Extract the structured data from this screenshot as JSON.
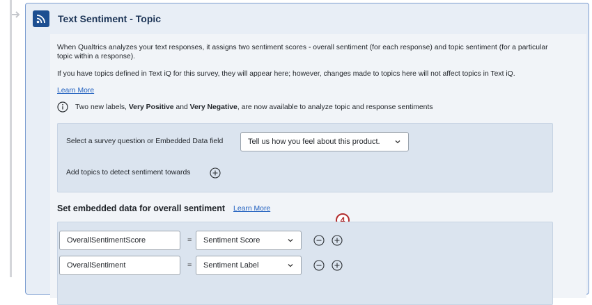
{
  "card": {
    "title": "Text Sentiment - Topic",
    "para1": "When Qualtrics analyzes your text responses, it assigns two sentiment scores - overall sentiment (for each response) and topic sentiment (for a particular topic within a response).",
    "para2": "If you have topics defined in Text iQ for this survey, they will appear here; however, changes made to topics here will not affect topics in Text iQ.",
    "learn_more": "Learn More",
    "notice": {
      "prefix": "Two new labels, ",
      "bold1": "Very Positive",
      "mid": " and ",
      "bold2": "Very Negative",
      "suffix": ", are now available to analyze topic and response sentiments"
    }
  },
  "question_panel": {
    "select_label": "Select a survey question or Embedded Data field",
    "select_value": "Tell us how you feel about this product.",
    "topics_label": "Add topics to detect sentiment towards"
  },
  "embedded": {
    "title": "Set embedded data for overall sentiment",
    "learn_more": "Learn More",
    "step_number": "4",
    "rows": [
      {
        "field": "OverallSentimentScore",
        "equals": "=",
        "value": "Sentiment Score"
      },
      {
        "field": "OverallSentiment",
        "equals": "=",
        "value": "Sentiment Label"
      }
    ]
  },
  "icons": {
    "header": "rss-icon",
    "info": "info-icon",
    "add": "plus-circle-icon",
    "remove": "minus-circle-icon",
    "dropdown": "chevron-down-icon"
  },
  "colors": {
    "accent": "#1d4f91",
    "link": "#1f5fbf",
    "annotation": "#b32d2e",
    "card_border": "#7a9cd0"
  }
}
